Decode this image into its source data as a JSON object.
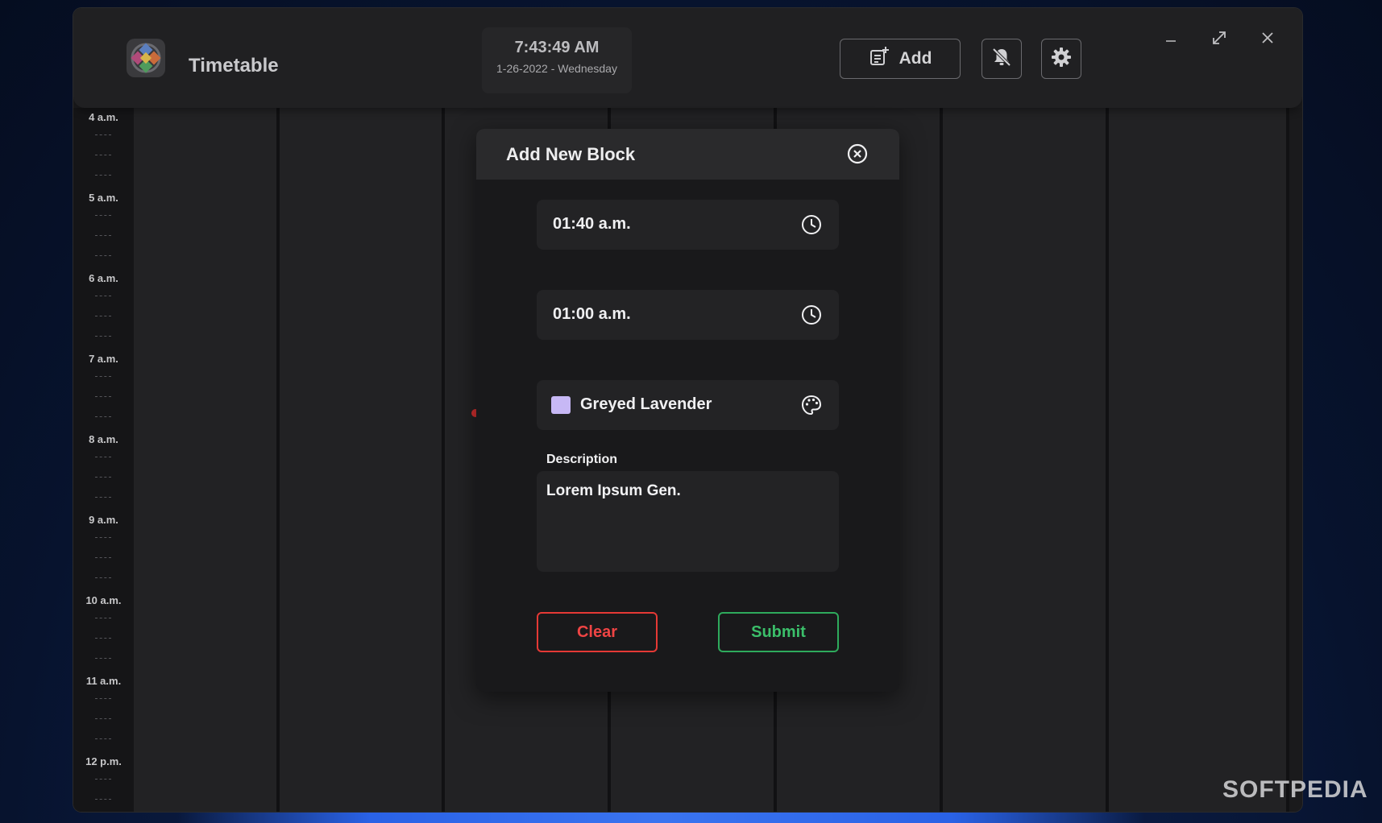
{
  "app": {
    "title": "Timetable"
  },
  "clock": {
    "time": "7:43:49 AM",
    "date": "1-26-2022 - Wednesday"
  },
  "toolbar": {
    "add_label": "Add"
  },
  "timeline": {
    "hours": [
      "4 a.m.",
      "5 a.m.",
      "6 a.m.",
      "7 a.m.",
      "8 a.m.",
      "9 a.m.",
      "10 a.m.",
      "11 a.m.",
      "12 p.m."
    ]
  },
  "modal": {
    "title": "Add New Block",
    "start_time": "01:40 a.m.",
    "end_time": "01:00 a.m.",
    "color_name": "Greyed Lavender",
    "color_hex": "#c7b8f5",
    "description_label": "Description",
    "description_value": "Lorem Ipsum Gen.",
    "clear_label": "Clear",
    "submit_label": "Submit"
  },
  "watermark": "SOFTPEDIA"
}
